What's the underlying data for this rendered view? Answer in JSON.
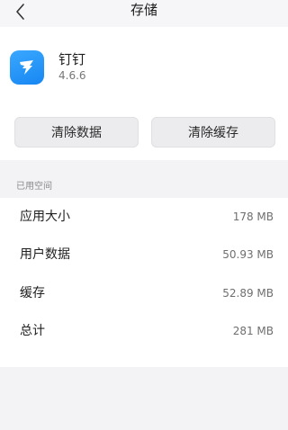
{
  "header": {
    "title": "存储",
    "back_icon": "chevron-left-icon"
  },
  "app": {
    "name": "钉钉",
    "version": "4.6.6",
    "icon": "dingtalk-logo-icon",
    "icon_color": "#1786f2"
  },
  "actions": {
    "clear_data_label": "清除数据",
    "clear_cache_label": "清除缓存"
  },
  "storage": {
    "section_label": "已用空间",
    "rows": [
      {
        "label": "应用大小",
        "value": "178 MB"
      },
      {
        "label": "用户数据",
        "value": "50.93 MB"
      },
      {
        "label": "缓存",
        "value": "52.89 MB"
      },
      {
        "label": "总计",
        "value": "281 MB"
      }
    ]
  }
}
